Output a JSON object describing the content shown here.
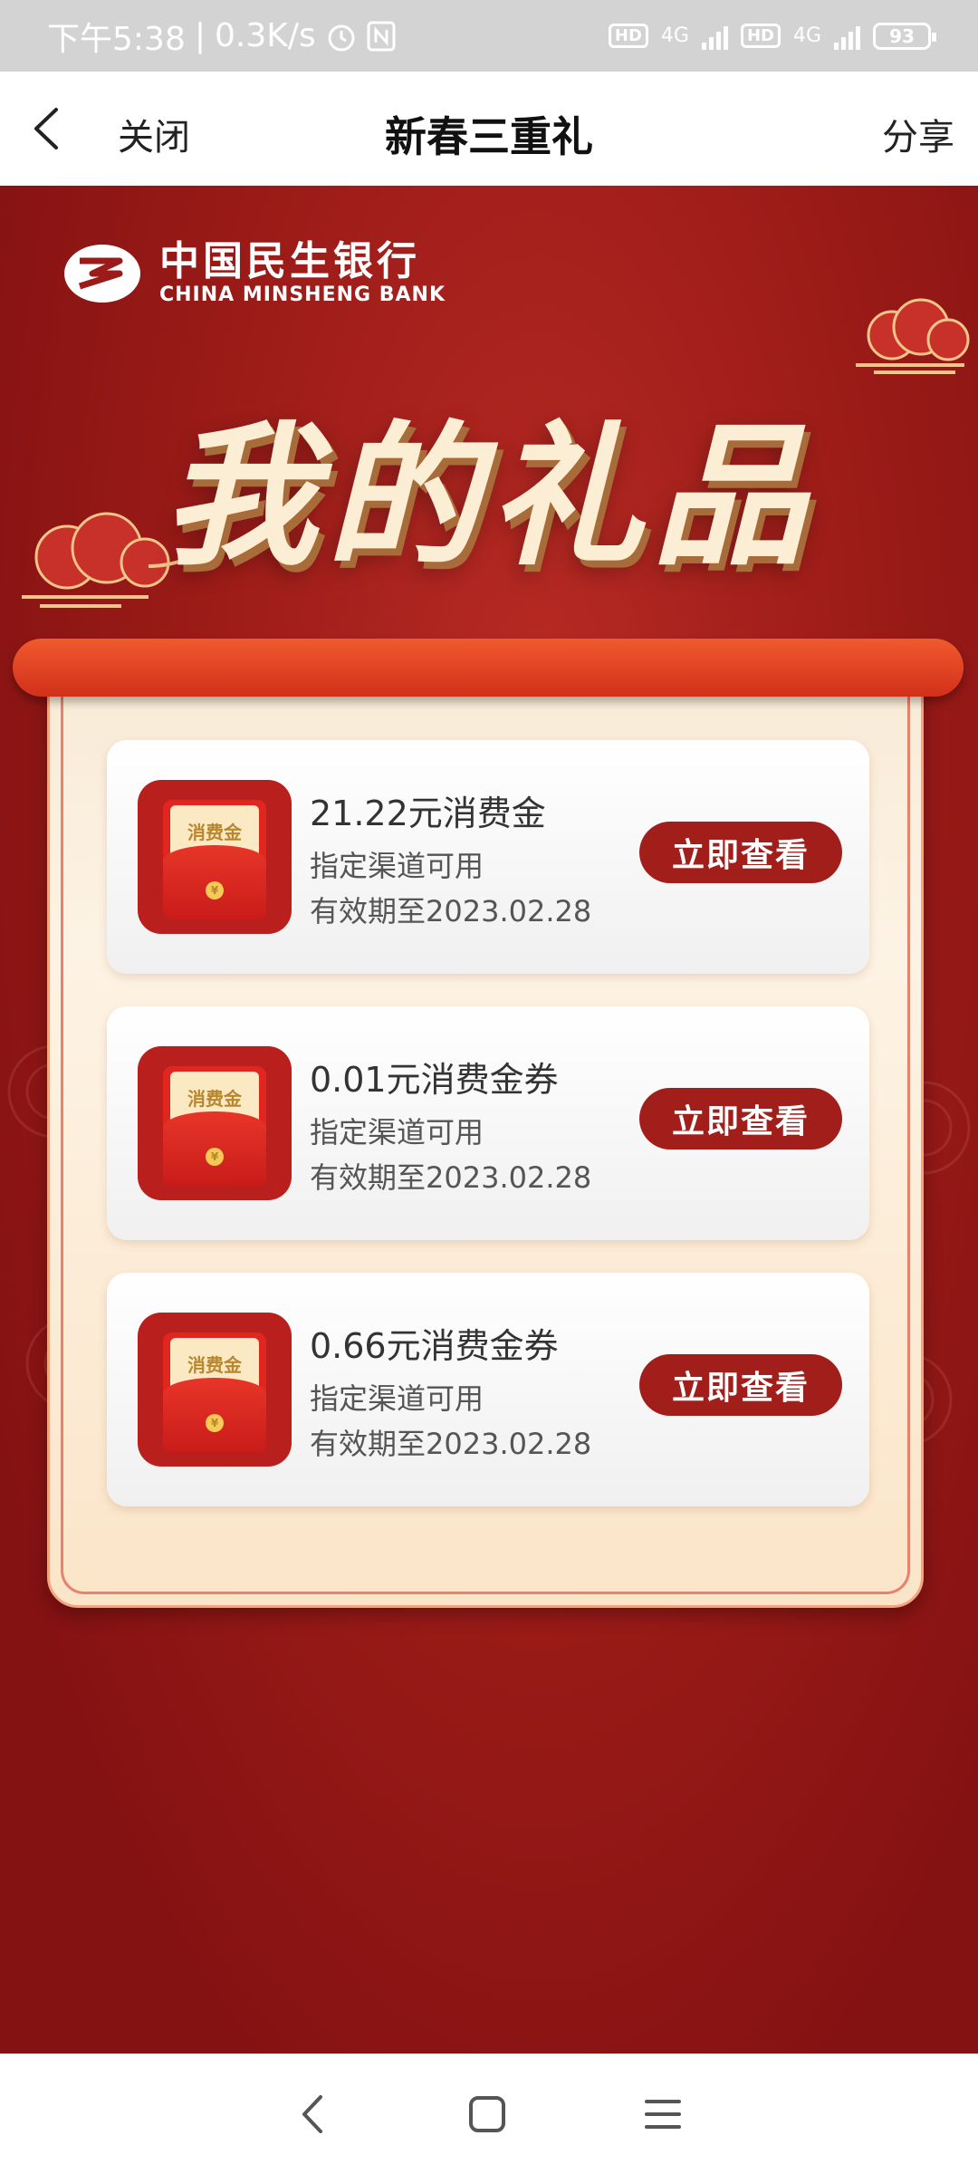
{
  "status_bar": {
    "time": "下午5:38",
    "net_speed": "0.3K/s",
    "badge1": "HD",
    "net1": "4G",
    "badge2": "HD",
    "net2": "4G",
    "battery": "93"
  },
  "nav": {
    "close_label": "关闭",
    "title": "新春三重礼",
    "share_label": "分享"
  },
  "bank": {
    "name_cn": "中国民生银行",
    "name_en": "CHINA MINSHENG BANK"
  },
  "hero_title": "我的礼品",
  "gift_icon_label": "消费金",
  "gifts": [
    {
      "title": "21.22元消费金",
      "channel": "指定渠道可用",
      "expiry": "有效期至2023.02.28",
      "button": "立即查看"
    },
    {
      "title": "0.01元消费金券",
      "channel": "指定渠道可用",
      "expiry": "有效期至2023.02.28",
      "button": "立即查看"
    },
    {
      "title": "0.66元消费金券",
      "channel": "指定渠道可用",
      "expiry": "有效期至2023.02.28",
      "button": "立即查看"
    }
  ],
  "colors": {
    "brand_red": "#a11e1a",
    "background": "#8a1414",
    "accent_orange": "#f05a2e",
    "paper": "#fdf3e4"
  },
  "icons": [
    "back-icon",
    "alarm-icon",
    "nfc-icon",
    "signal-icon",
    "battery-icon",
    "bank-logo-icon",
    "red-envelope-icon",
    "cloud-decoration",
    "sys-back-icon",
    "sys-home-icon",
    "sys-menu-icon"
  ]
}
